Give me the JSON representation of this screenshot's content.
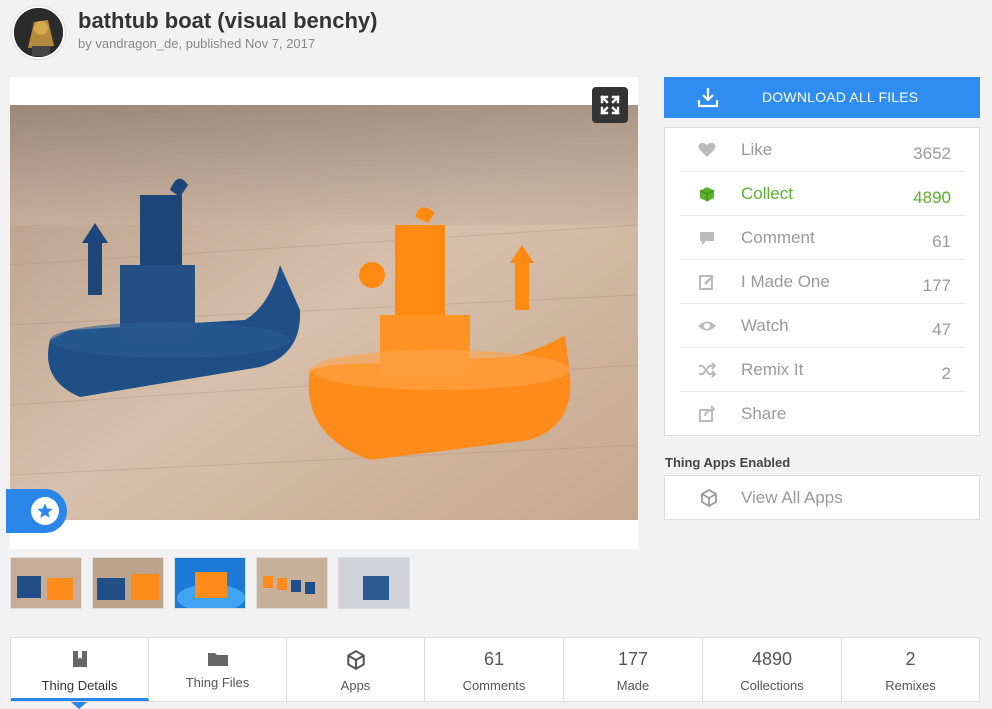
{
  "header": {
    "title": "bathtub boat (visual benchy)",
    "byline_prefix": "by ",
    "author": "vandragon_de",
    "published": ", published Nov 7, 2017"
  },
  "download": {
    "label": "DOWNLOAD ALL FILES"
  },
  "actions": [
    {
      "label": "Like",
      "count": "3652",
      "icon": "heart-icon"
    },
    {
      "label": "Collect",
      "count": "4890",
      "icon": "collect-icon"
    },
    {
      "label": "Comment",
      "count": "61",
      "icon": "comment-icon"
    },
    {
      "label": "I Made One",
      "count": "177",
      "icon": "edit-icon"
    },
    {
      "label": "Watch",
      "count": "47",
      "icon": "eye-icon"
    },
    {
      "label": "Remix It",
      "count": "2",
      "icon": "shuffle-icon"
    },
    {
      "label": "Share",
      "count": "",
      "icon": "share-icon"
    }
  ],
  "apps": {
    "heading": "Thing Apps Enabled",
    "view_all": "View All Apps"
  },
  "tabs": [
    {
      "label": "Thing Details",
      "icon": "bookmark-icon"
    },
    {
      "label": "Thing Files",
      "icon": "folder-icon"
    },
    {
      "label": "Apps",
      "icon": "cube-icon"
    },
    {
      "number": "61",
      "label": "Comments"
    },
    {
      "number": "177",
      "label": "Made"
    },
    {
      "number": "4890",
      "label": "Collections"
    },
    {
      "number": "2",
      "label": "Remixes"
    }
  ],
  "colors": {
    "accent": "#2f8cf0",
    "collect_green": "#5ab12b",
    "boat_blue": "#1f4f86",
    "boat_orange": "#ff8c1a"
  }
}
